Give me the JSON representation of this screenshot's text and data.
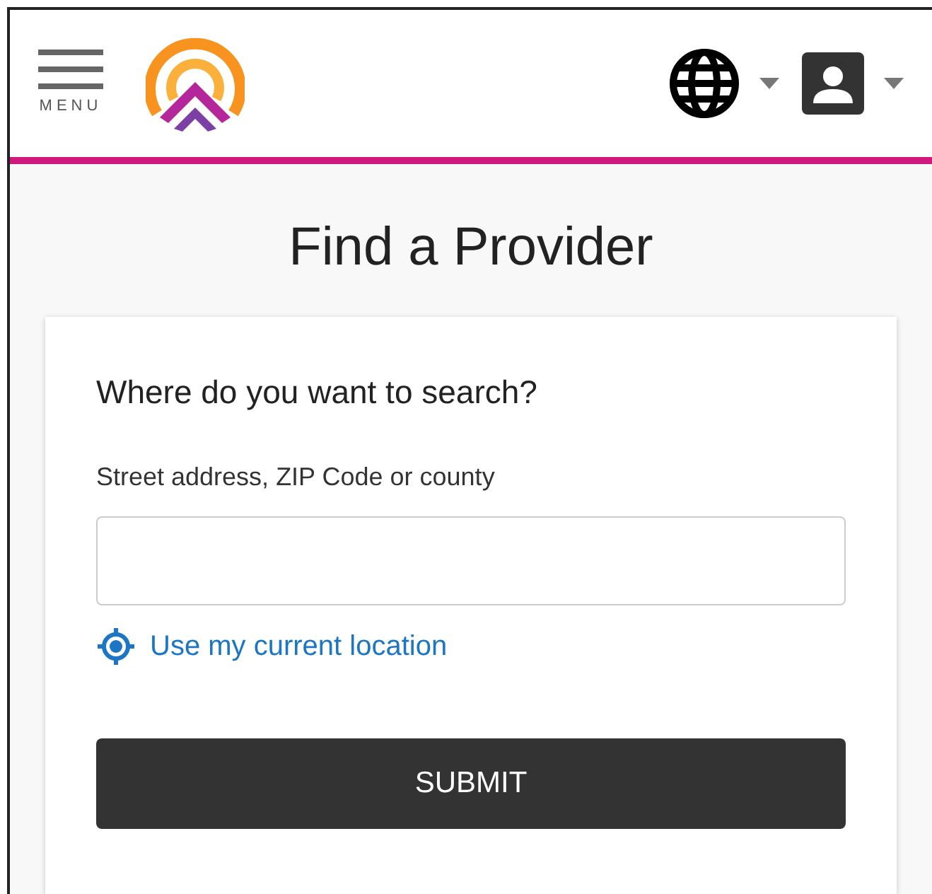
{
  "header": {
    "menu_label": "MENU"
  },
  "title": "Find a Provider",
  "search_card": {
    "heading": "Where do you want to search?",
    "field_label": "Street address, ZIP Code or county",
    "location_link": "Use my current location",
    "submit": "SUBMIT"
  }
}
